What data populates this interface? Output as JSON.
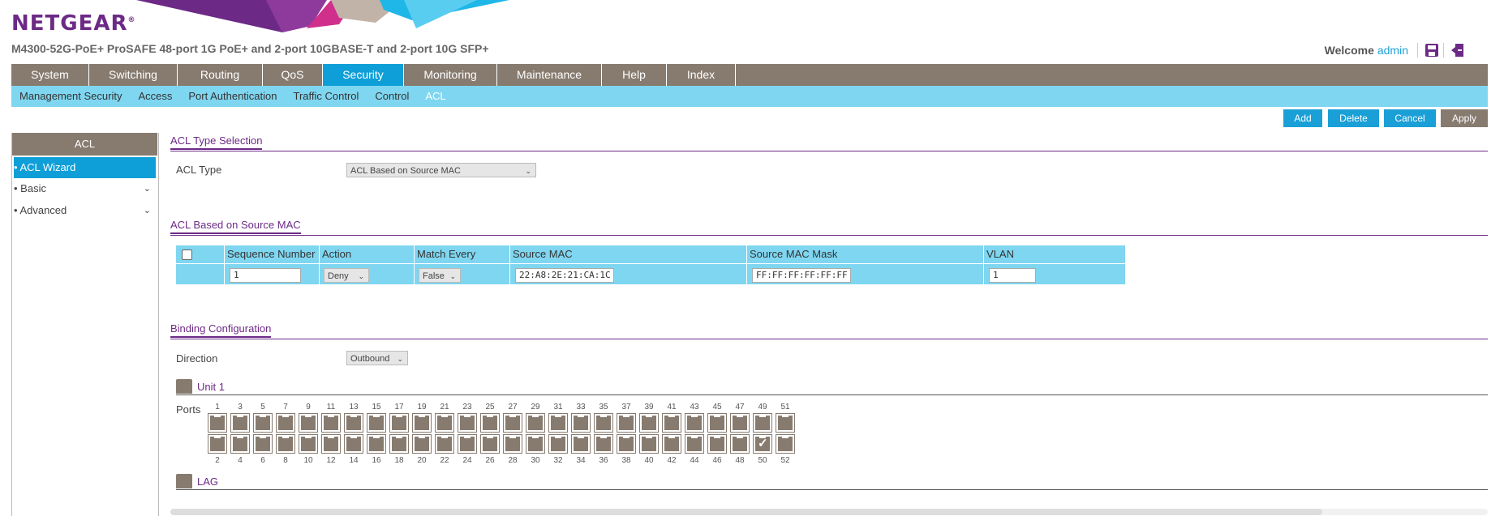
{
  "header": {
    "logo": "NETGEAR",
    "logo_mark": "®",
    "model": "M4300-52G-PoE+ ProSAFE 48-port 1G PoE+ and 2-port 10GBASE-T and 2-port 10G SFP+",
    "welcome": "Welcome",
    "user": "admin"
  },
  "colors": {
    "purple": "#6c2a86",
    "blue": "#0f9fd8",
    "gray": "#877b70",
    "light_blue": "#7fd6f0"
  },
  "main_nav": [
    "System",
    "Switching",
    "Routing",
    "QoS",
    "Security",
    "Monitoring",
    "Maintenance",
    "Help",
    "Index"
  ],
  "main_nav_active": "Security",
  "sub_nav": [
    "Management Security",
    "Access",
    "Port Authentication",
    "Traffic Control",
    "Control",
    "ACL"
  ],
  "sub_nav_active": "ACL",
  "actions": {
    "add": "Add",
    "delete": "Delete",
    "cancel": "Cancel",
    "apply": "Apply"
  },
  "sidebar": {
    "title": "ACL",
    "items": [
      "• ACL Wizard",
      "• Basic",
      "• Advanced"
    ]
  },
  "type_section": {
    "title": "ACL Type Selection",
    "label": "ACL Type",
    "value": "ACL Based on Source MAC"
  },
  "mac_section": {
    "title": "ACL Based on Source MAC",
    "columns": [
      "Sequence Number",
      "Action",
      "Match Every",
      "Source MAC",
      "Source MAC Mask",
      "VLAN"
    ],
    "row": {
      "sequence": "1",
      "action": "Deny",
      "match_every": "False",
      "source_mac": "22:A8:2E:21:CA:1C",
      "mask": "FF:FF:FF:FF:FF:FF",
      "vlan": "1"
    }
  },
  "binding": {
    "title": "Binding Configuration",
    "direction_label": "Direction",
    "direction": "Outbound",
    "unit_label": "Unit 1",
    "ports_label": "Ports",
    "top_ports": [
      "1",
      "3",
      "5",
      "7",
      "9",
      "11",
      "13",
      "15",
      "17",
      "19",
      "21",
      "23",
      "25",
      "27",
      "29",
      "31",
      "33",
      "35",
      "37",
      "39",
      "41",
      "43",
      "45",
      "47",
      "49",
      "51"
    ],
    "bottom_ports": [
      "2",
      "4",
      "6",
      "8",
      "10",
      "12",
      "14",
      "16",
      "18",
      "20",
      "22",
      "24",
      "26",
      "28",
      "30",
      "32",
      "34",
      "36",
      "38",
      "40",
      "42",
      "44",
      "46",
      "48",
      "50",
      "52"
    ],
    "checked_ports": [
      "50"
    ],
    "lag_label": "LAG"
  }
}
